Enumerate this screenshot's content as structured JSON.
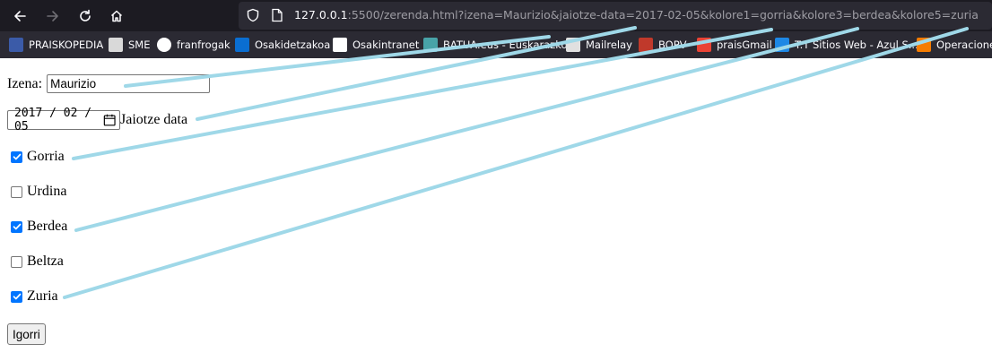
{
  "browser": {
    "url_host": "127.0.0.1",
    "url_rest": ":5500/zerenda.html?izena=Maurizio&jaiotze-data=2017-02-05&kolore1=gorria&kolore3=berdea&kolore5=zuria",
    "bookmarks": [
      {
        "label": "PRAISKOPEDIA",
        "icon": "praiskopedia-icon",
        "color": "#3b5ba8"
      },
      {
        "label": "SME",
        "icon": "film-icon",
        "color": "#d9d9d9"
      },
      {
        "label": "franfrogak",
        "icon": "wordpress-icon",
        "color": "#ffffff"
      },
      {
        "label": "Osakidetzakoa",
        "icon": "sap-icon",
        "color": "#0a6ed1"
      },
      {
        "label": "Osakintranet",
        "icon": "osakidetza-icon",
        "color": "#ffffff"
      },
      {
        "label": "BATUA.eus - Euskarazko...",
        "icon": "batua-icon",
        "color": "#48a3a8"
      },
      {
        "label": "Mailrelay",
        "icon": "image-icon",
        "color": "#e0e0e0"
      },
      {
        "label": "BOPV",
        "icon": "bopv-icon",
        "color": "#c0392b"
      },
      {
        "label": "praisGmail",
        "icon": "gmail-icon",
        "color": "#ea4335"
      },
      {
        "label": "T.T Sitios Web - Azul S...",
        "icon": "sitios-icon",
        "color": "#1e88e5"
      },
      {
        "label": "Operaciones",
        "icon": "triangle-icon",
        "color": "#f57c00"
      }
    ]
  },
  "form": {
    "name_label": "Izena:",
    "name_value": "Maurizio",
    "date_value": "2017 / 02 / 05",
    "date_label": "Jaiotze data",
    "colors": [
      {
        "label": "Gorria",
        "checked": true
      },
      {
        "label": "Urdina",
        "checked": false
      },
      {
        "label": "Berdea",
        "checked": true
      },
      {
        "label": "Beltza",
        "checked": false
      },
      {
        "label": "Zuria",
        "checked": true
      }
    ],
    "submit_label": "Igorri"
  },
  "annotation_color": "#9fd8e8"
}
